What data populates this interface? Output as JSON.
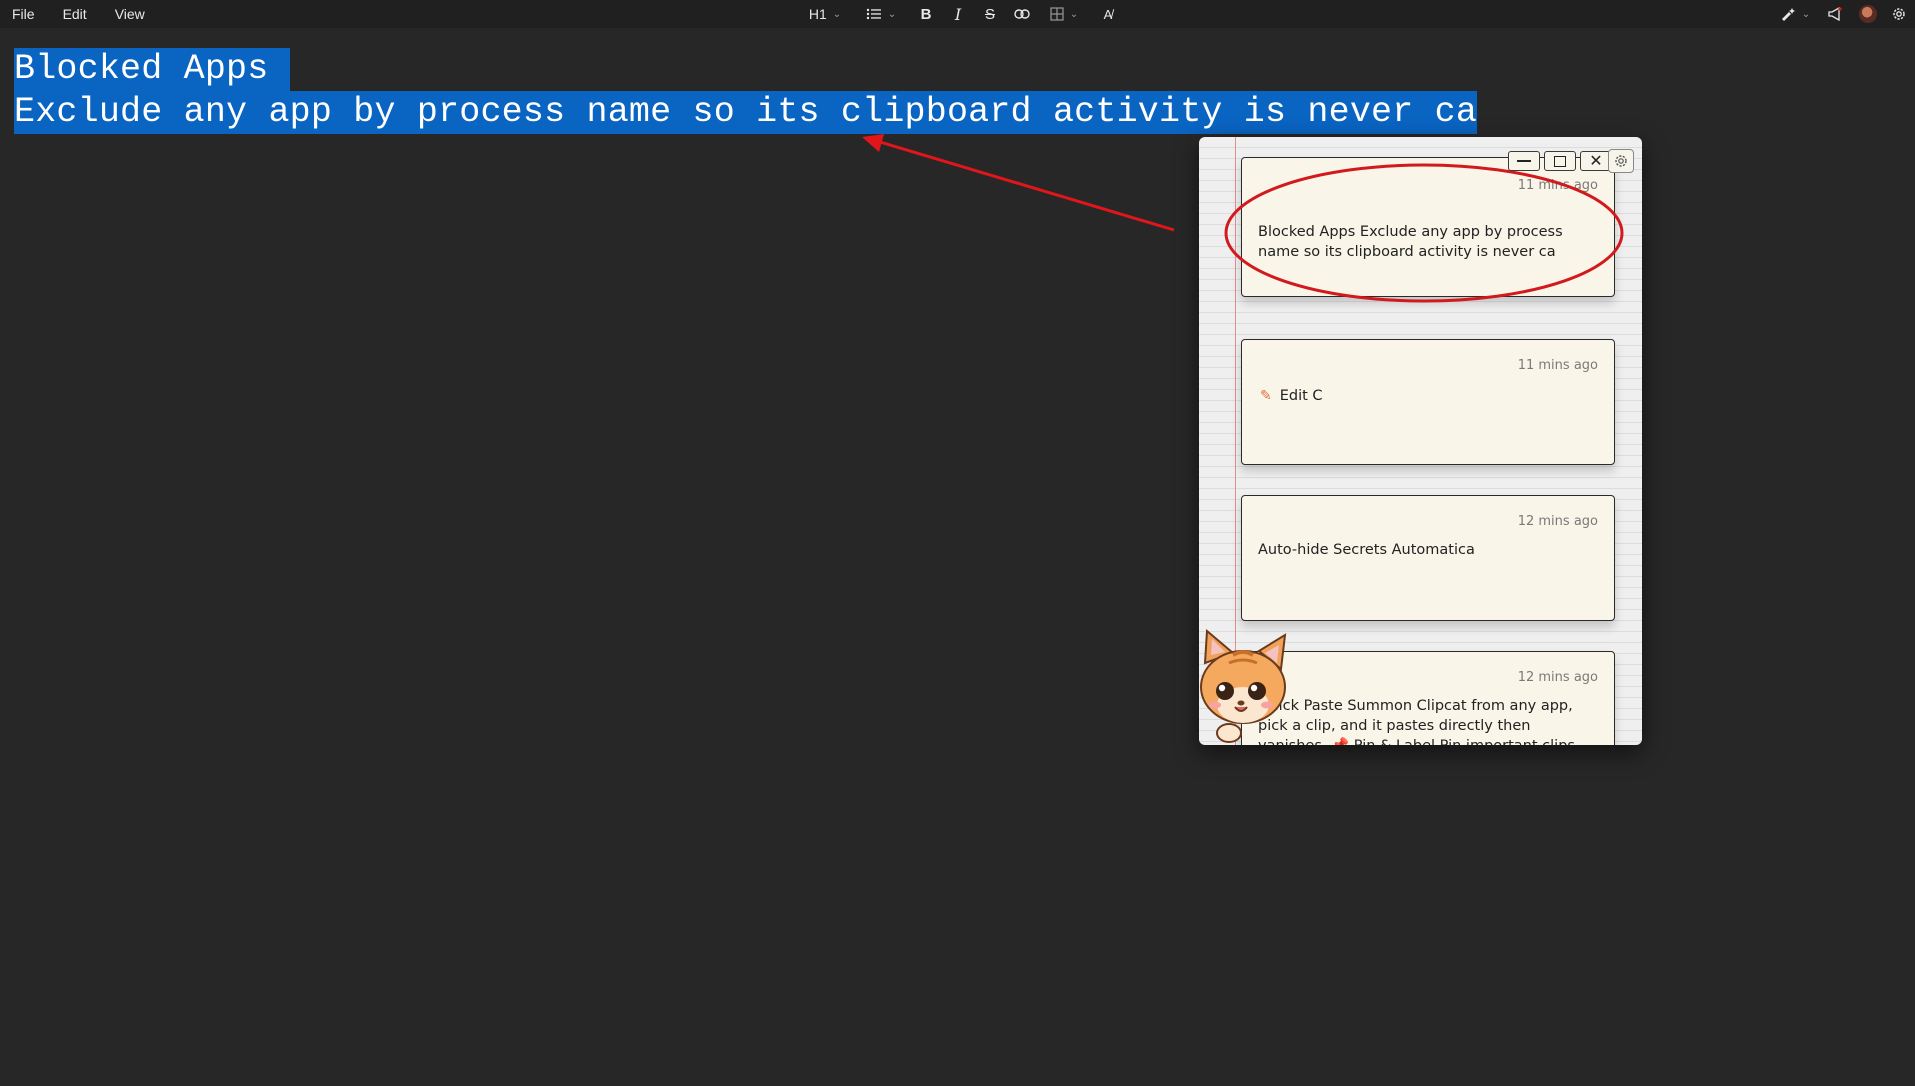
{
  "menubar": {
    "menus": [
      "File",
      "Edit",
      "View"
    ],
    "heading_label": "H1"
  },
  "editor": {
    "selected_line1": "Blocked Apps ",
    "selected_line2": "Exclude any app by process name so its clipboard activity is never ca"
  },
  "clip_window": {
    "cards": [
      {
        "time": "11 mins ago",
        "text": "Blocked Apps Exclude any app by process name so its clipboard activity is never ca"
      },
      {
        "time": "11 mins ago",
        "text": "Edit C"
      },
      {
        "time": "12 mins ago",
        "text": "Auto-hide Secrets Automatica"
      },
      {
        "time": "12 mins ago",
        "text": "Quick Paste Summon Clipcat from any app, pick a clip, and it pastes directly then vanishes. 📌 Pin & Label Pin important clips"
      }
    ]
  },
  "colors": {
    "selection": "#0a64c2",
    "annotation": "#e0161b",
    "card_bg": "#f9f5e8"
  }
}
